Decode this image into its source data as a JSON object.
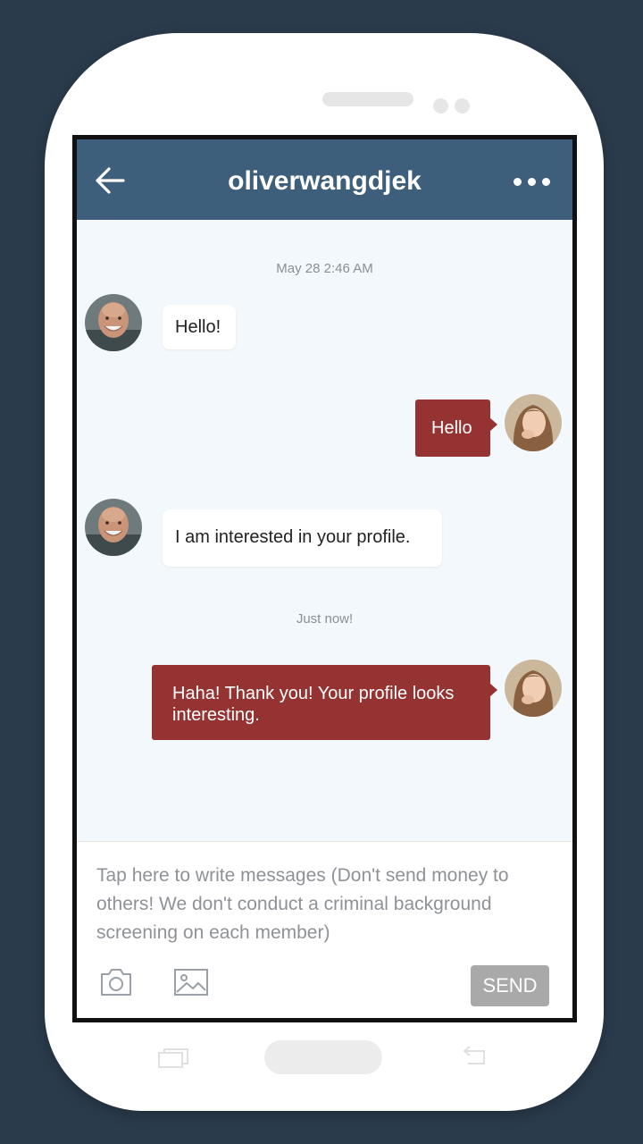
{
  "header": {
    "title": "oliverwangdjek",
    "back_icon": "arrow-left-icon",
    "more_icon": "more-horizontal-icon"
  },
  "messages": [
    {
      "type": "timestamp",
      "text": "May 28 2:46 AM"
    },
    {
      "type": "incoming",
      "text": "Hello!"
    },
    {
      "type": "outgoing",
      "text": "Hello"
    },
    {
      "type": "incoming",
      "text": "I am interested in your profile."
    },
    {
      "type": "timestamp",
      "text": "Just now!"
    },
    {
      "type": "outgoing",
      "text": "Haha! Thank you! Your profile looks interesting."
    }
  ],
  "composer": {
    "placeholder": "Tap here to write messages (Don't send money to others! We don't conduct a criminal background screening on each member)",
    "value": "",
    "camera_icon": "camera-icon",
    "image_icon": "image-icon",
    "send_label": "SEND"
  },
  "colors": {
    "header": "#3e5f7b",
    "outgoing_bubble": "#953333",
    "incoming_bubble": "#ffffff",
    "chat_background": "#f3f8fc",
    "send_button": "#a9a9a9",
    "frame_background": "#2a3b4c"
  }
}
